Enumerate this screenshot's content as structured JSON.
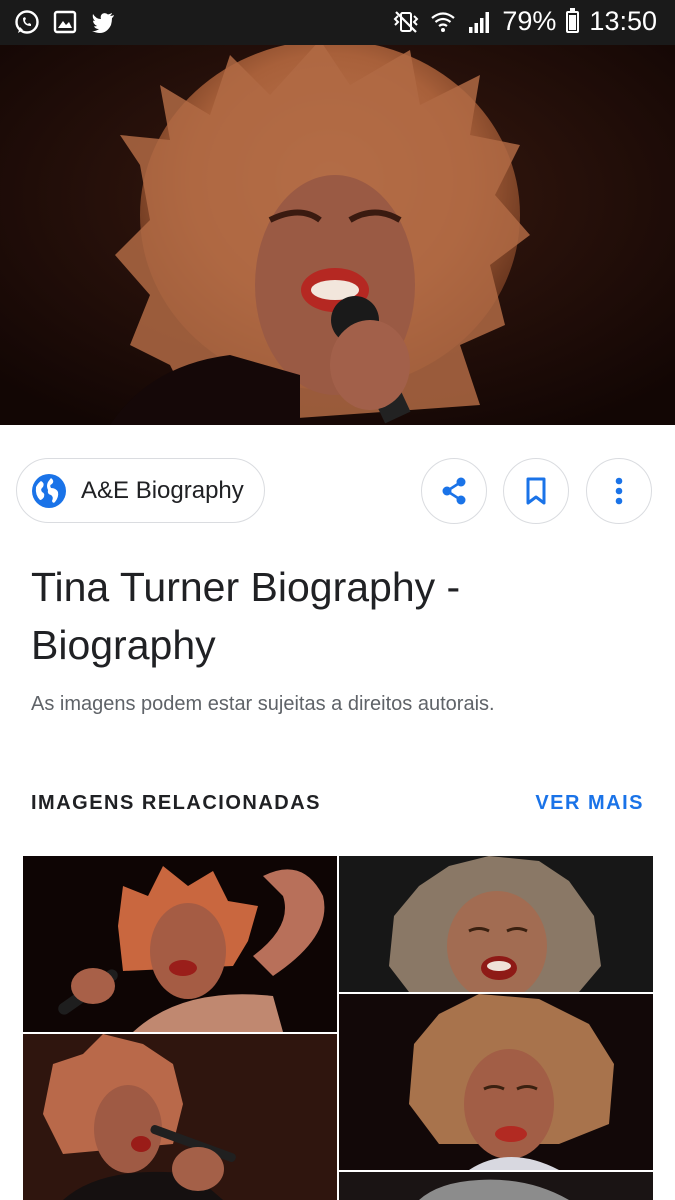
{
  "status_bar": {
    "battery": "79%",
    "time": "13:50",
    "battery_level": 0.79,
    "left_icons": [
      "whatsapp-icon",
      "gallery-icon",
      "twitter-icon"
    ],
    "right_icons": [
      "vibrate-icon",
      "wifi-icon",
      "signal-icon",
      "battery-icon"
    ]
  },
  "result": {
    "source": "A&E Biography",
    "title": "Tina Turner Biography - Biography",
    "copyright_notice": "As imagens podem estar sujeitas a direitos autorais."
  },
  "actions": [
    "share-icon",
    "bookmark-icon",
    "more-vert-icon"
  ],
  "related": {
    "header": "IMAGENS RELACIONADAS",
    "see_more": "VER MAIS"
  },
  "colors": {
    "accent": "#1a73e8",
    "status_bar": "#1a1a1a",
    "text_primary": "#202124",
    "text_secondary": "#5f6368"
  }
}
